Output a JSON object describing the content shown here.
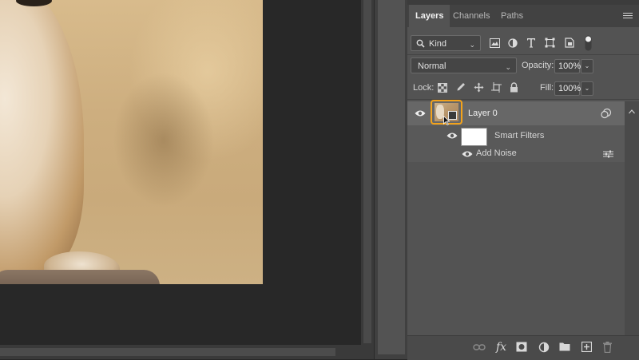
{
  "panel": {
    "tabs": [
      "Layers",
      "Channels",
      "Paths"
    ],
    "active_tab": "Layers"
  },
  "filter": {
    "kind_label": "Kind"
  },
  "blend": {
    "mode": "Normal",
    "opacity_label": "Opacity:",
    "opacity_value": "100%"
  },
  "lock": {
    "label": "Lock:",
    "fill_label": "Fill:",
    "fill_value": "100%"
  },
  "layers": {
    "layer_name": "Layer 0",
    "smart_filters_label": "Smart Filters",
    "filter_name": "Add Noise"
  },
  "colors": {
    "accent_highlight": "#f4a31b",
    "panel_bg": "#535353",
    "selected_row": "#676767",
    "canvas_bg": "#282828"
  }
}
